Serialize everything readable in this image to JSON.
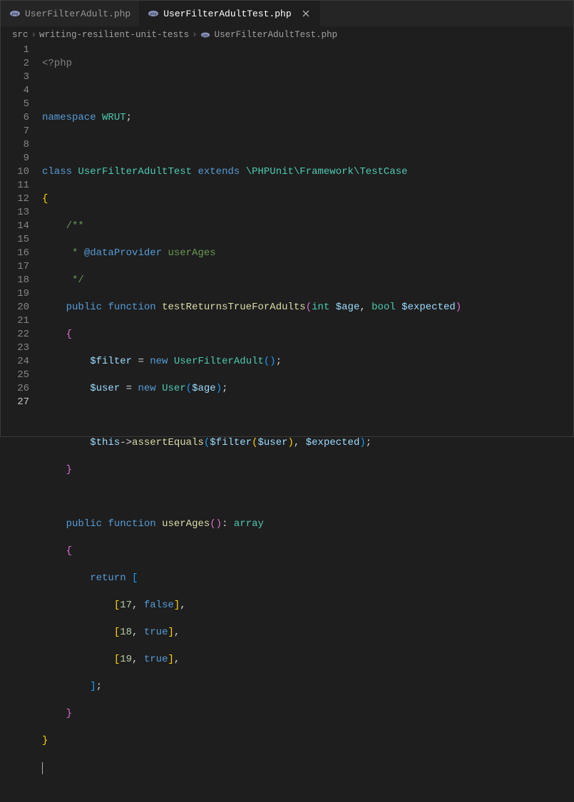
{
  "tabs": [
    {
      "label": "UserFilterAdult.php",
      "active": false
    },
    {
      "label": "UserFilterAdultTest.php",
      "active": true
    }
  ],
  "breadcrumbs": {
    "parts": [
      "src",
      "writing-resilient-unit-tests",
      "UserFilterAdultTest.php"
    ],
    "separator": "›"
  },
  "colors": {
    "background": "#1e1e1e",
    "php_icon": "#8993be"
  },
  "line_count": 27,
  "current_line": 27,
  "code": {
    "php_open": "<?php",
    "namespace_kw": "namespace",
    "namespace_name": "WRUT",
    "class_kw": "class",
    "class_name": "UserFilterAdultTest",
    "extends_kw": "extends",
    "parent_class": "\\PHPUnit\\Framework\\TestCase",
    "doc_open": "/**",
    "doc_line": " * ",
    "doc_tag": "@dataProvider",
    "doc_provider": "userAges",
    "doc_close": " */",
    "public_kw": "public",
    "function_kw": "function",
    "method1": "testReturnsTrueForAdults",
    "param1_type": "int",
    "param1_name": "$age",
    "param2_type": "bool",
    "param2_name": "$expected",
    "var_filter": "$filter",
    "new_kw": "new",
    "cls_ufa": "UserFilterAdult",
    "var_user": "$user",
    "cls_user": "User",
    "this_var": "$this",
    "assert_fn": "assertEquals",
    "method2": "userAges",
    "return_type": "array",
    "return_kw": "return",
    "rows": [
      {
        "n": "17",
        "b": "false"
      },
      {
        "n": "18",
        "b": "true"
      },
      {
        "n": "19",
        "b": "true"
      }
    ]
  }
}
